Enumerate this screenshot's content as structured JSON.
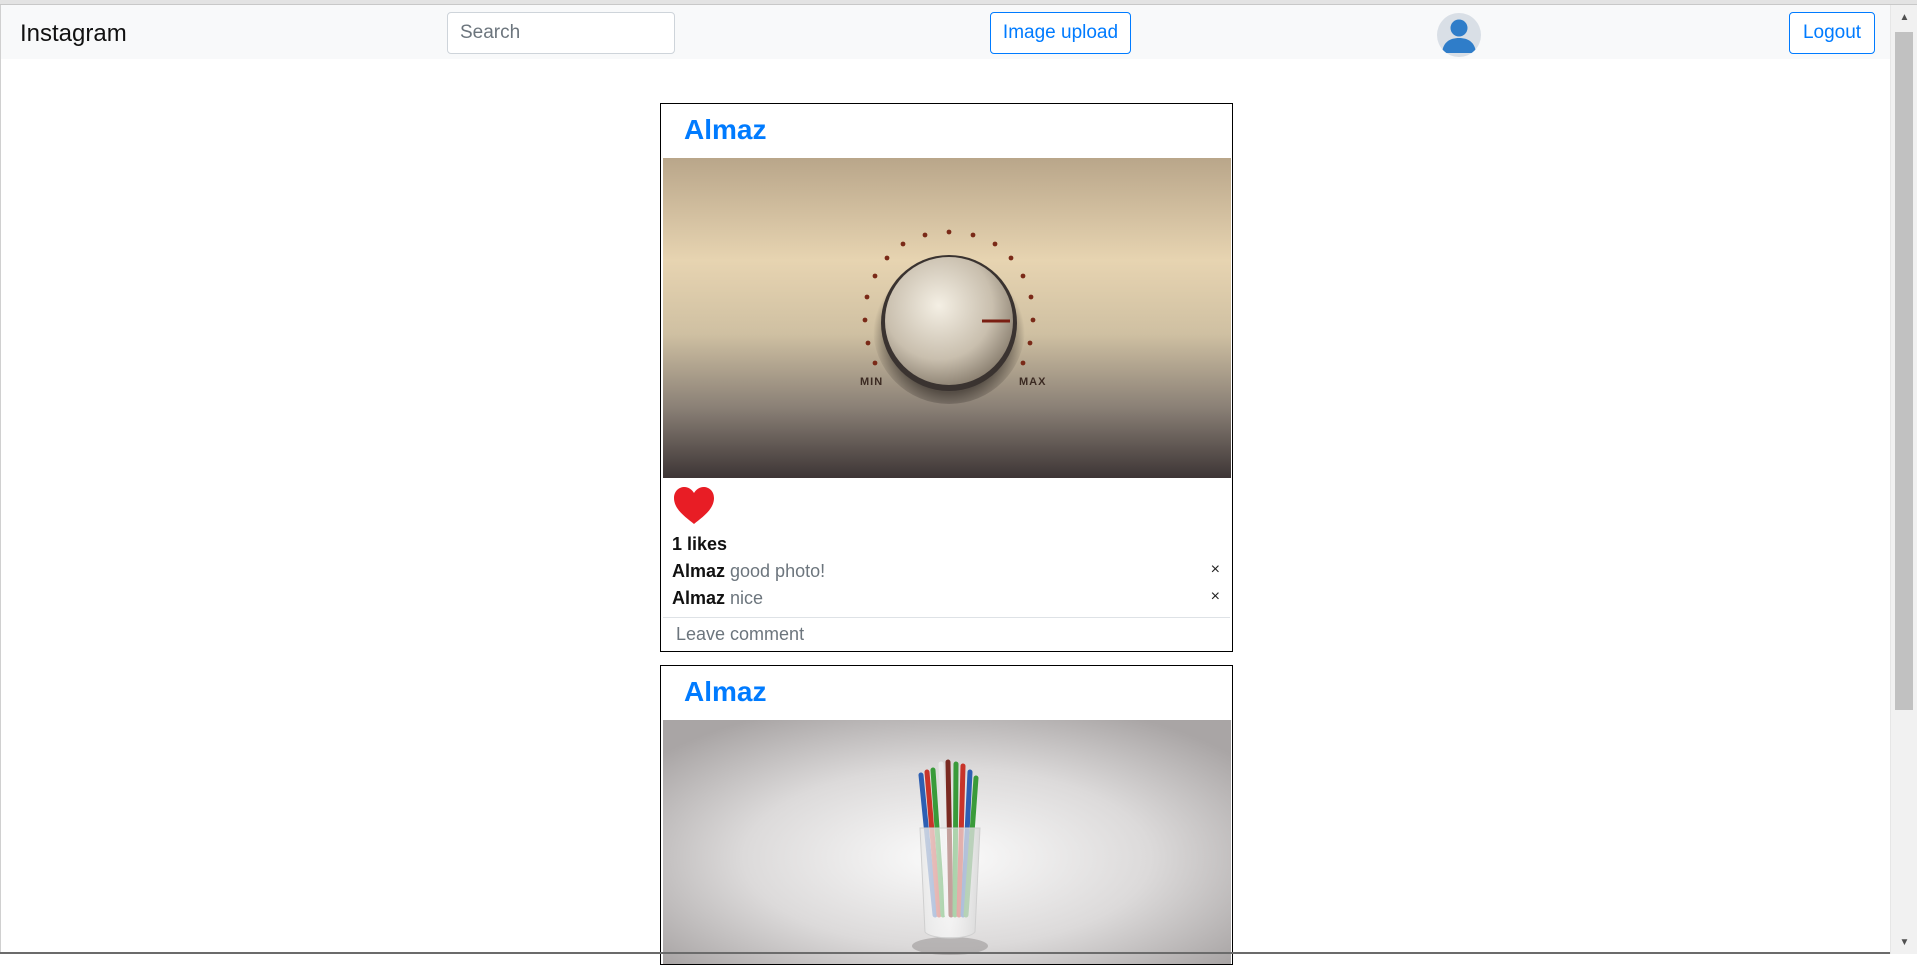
{
  "navbar": {
    "brand": "Instagram",
    "search_placeholder": "Search",
    "upload_label": "Image upload",
    "logout_label": "Logout"
  },
  "colors": {
    "accent": "#007bff",
    "like": "#e81d25",
    "navbar_bg": "#f8f9fa"
  },
  "posts": [
    {
      "author": "Almaz",
      "image": "volume-knob-photo",
      "image_labels": {
        "min": "MIN",
        "max": "MAX"
      },
      "liked": true,
      "likes_count": "1",
      "likes_label": "likes",
      "comments": [
        {
          "author": "Almaz",
          "text": "good photo!",
          "delete": "×"
        },
        {
          "author": "Almaz",
          "text": "nice",
          "delete": "×"
        }
      ],
      "comment_placeholder": "Leave comment"
    },
    {
      "author": "Almaz",
      "image": "colored-pencils-cup-photo"
    }
  ]
}
